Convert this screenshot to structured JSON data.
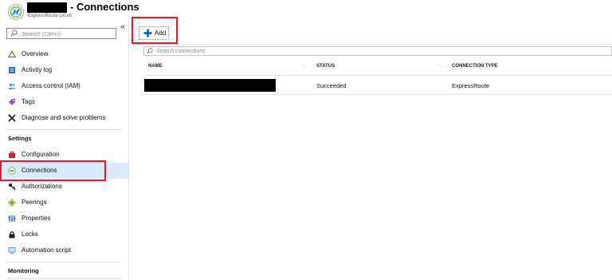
{
  "header": {
    "title": "- Connections",
    "subtitle": "ExpressRoute circuit"
  },
  "sidebar": {
    "search": {
      "placeholder": "Search (Ctrl+/)"
    },
    "collapse_label": "«",
    "items": [
      {
        "label": "Overview",
        "icon": "triangle-icon"
      },
      {
        "label": "Activity log",
        "icon": "log-icon"
      },
      {
        "label": "Access control (IAM)",
        "icon": "people-icon"
      },
      {
        "label": "Tags",
        "icon": "tag-icon"
      },
      {
        "label": "Diagnose and solve problems",
        "icon": "wrench-icon"
      }
    ],
    "settings_header": "Settings",
    "settings_items": [
      {
        "label": "Configuration",
        "icon": "toolbox-icon"
      },
      {
        "label": "Connections",
        "icon": "connections-icon",
        "selected": true
      },
      {
        "label": "Authorizations",
        "icon": "key-icon"
      },
      {
        "label": "Peerings",
        "icon": "peering-icon"
      },
      {
        "label": "Properties",
        "icon": "properties-icon"
      },
      {
        "label": "Locks",
        "icon": "lock-icon"
      },
      {
        "label": "Automation script",
        "icon": "script-icon"
      }
    ],
    "monitoring_header": "Monitoring"
  },
  "toolbar": {
    "add_label": "Add"
  },
  "table": {
    "search_placeholder": "Search connections",
    "columns": [
      "NAME",
      "STATUS",
      "CONNECTION TYPE"
    ],
    "sort_glyph": "↑↓",
    "rows": [
      {
        "status": "Succeeded",
        "connection_type": "ExpressRoute"
      }
    ]
  },
  "colors": {
    "highlight": "#e01f2a",
    "selected_bg": "#d9ebfa",
    "accent": "#0072c6"
  }
}
